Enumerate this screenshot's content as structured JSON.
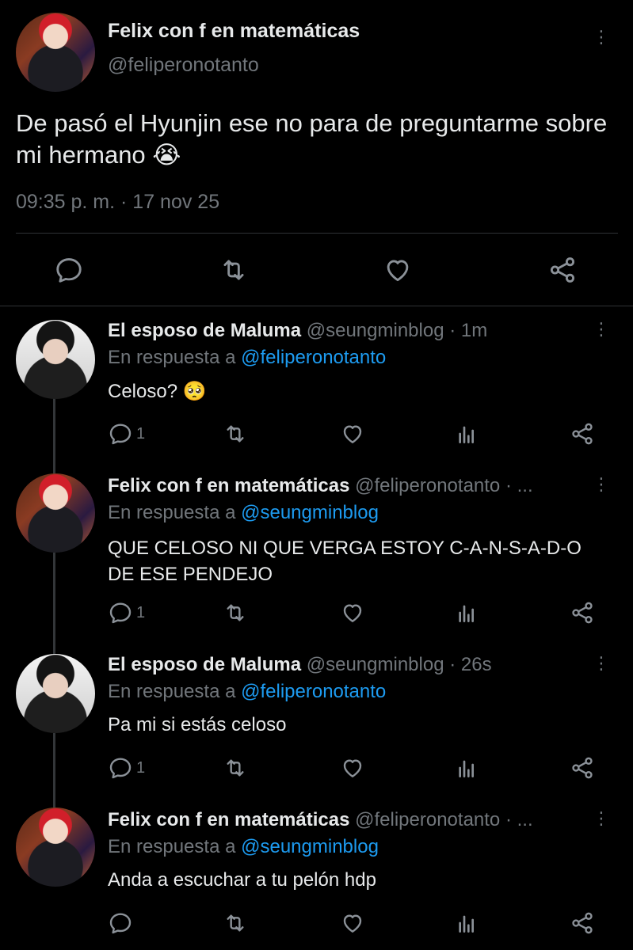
{
  "main_tweet": {
    "display_name": "Felix con f en matemáticas",
    "handle": "@feliperonotanto",
    "text": "De pasó el Hyunjin ese no para de preguntarme sobre mi hermano 😭",
    "timestamp": "09:35 p. m. · 17 nov 25"
  },
  "replies": [
    {
      "display_name": "El esposo de Maluma",
      "handle_time": "@seungminblog · 1m",
      "reply_prefix": "En respuesta a",
      "reply_to": "@feliperonotanto",
      "text": "Celoso? 🥺",
      "reply_count": "1"
    },
    {
      "display_name": "Felix con f en matemáticas",
      "handle_time": "@feliperonotanto · ...",
      "reply_prefix": "En respuesta a",
      "reply_to": "@seungminblog",
      "text_line1": "QUE CELOSO NI QUE VERGA ESTOY C-A-N-S-A-D-O",
      "text_line2": "DE ESE PENDEJO",
      "reply_count": "1"
    },
    {
      "display_name": "El esposo de Maluma",
      "handle_time": "@seungminblog · 26s",
      "reply_prefix": "En respuesta a",
      "reply_to": "@feliperonotanto",
      "text": "Pa mi si estás celoso",
      "reply_count": "1"
    },
    {
      "display_name": "Felix con f en matemáticas",
      "handle_time": "@feliperonotanto · ...",
      "reply_prefix": "En respuesta a",
      "reply_to": "@seungminblog",
      "text": "Anda a escuchar a tu pelón hdp",
      "reply_count": ""
    }
  ],
  "icons": {
    "more": "more-vertical-icon",
    "reply": "comment-icon",
    "retweet": "retweet-icon",
    "like": "heart-icon",
    "views": "analytics-icon",
    "share": "share-icon"
  },
  "colors": {
    "background": "#000000",
    "text": "#e7e9ea",
    "muted": "#71767b",
    "link": "#1d9bf0",
    "divider": "#2f3336"
  }
}
